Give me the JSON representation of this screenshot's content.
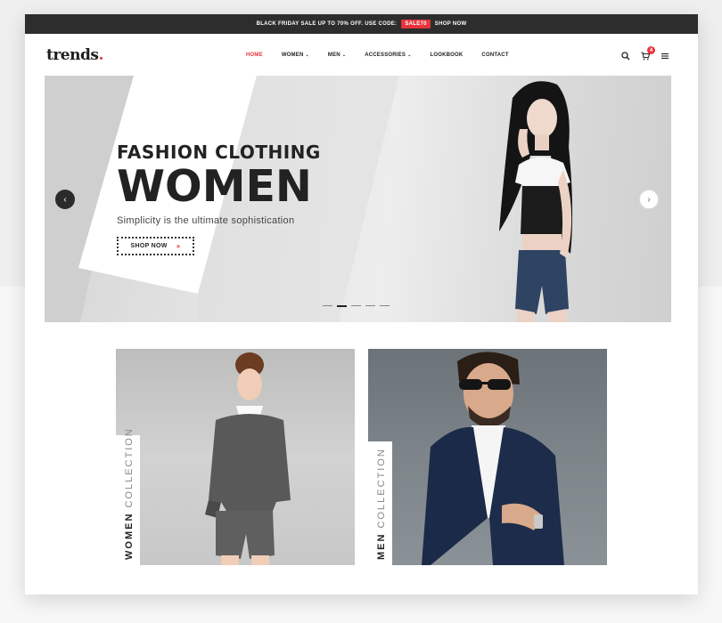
{
  "promo": {
    "text": "BLACK FRIDAY SALE UP TO 70% OFF. USE CODE:",
    "code": "SALE70",
    "link": "SHOP NOW"
  },
  "header": {
    "logo": "trends",
    "logo_dot": ".",
    "nav": [
      {
        "label": "HOME",
        "active": true
      },
      {
        "label": "WOMEN",
        "dropdown": true
      },
      {
        "label": "MEN",
        "dropdown": true
      },
      {
        "label": "ACCESSORIES",
        "dropdown": true
      },
      {
        "label": "LOOKBOOK"
      },
      {
        "label": "CONTACT"
      }
    ],
    "cart_count": "4",
    "icons": [
      "search-icon",
      "cart-icon",
      "menu-icon"
    ]
  },
  "hero": {
    "subtitle": "FASHION CLOTHING",
    "title": "WOMEN",
    "tagline": "Simplicity is the ultimate sophistication",
    "button": "SHOP NOW",
    "button_arrow": "»",
    "prev": "‹",
    "next": "›",
    "slides": 5,
    "active_slide": 2
  },
  "collections": [
    {
      "bold": "WOMEN",
      "light": "COLLECTION"
    },
    {
      "bold": "MEN",
      "light": "COLLECTION"
    }
  ],
  "colors": {
    "accent": "#e8343c",
    "dark": "#2d2d2d"
  }
}
